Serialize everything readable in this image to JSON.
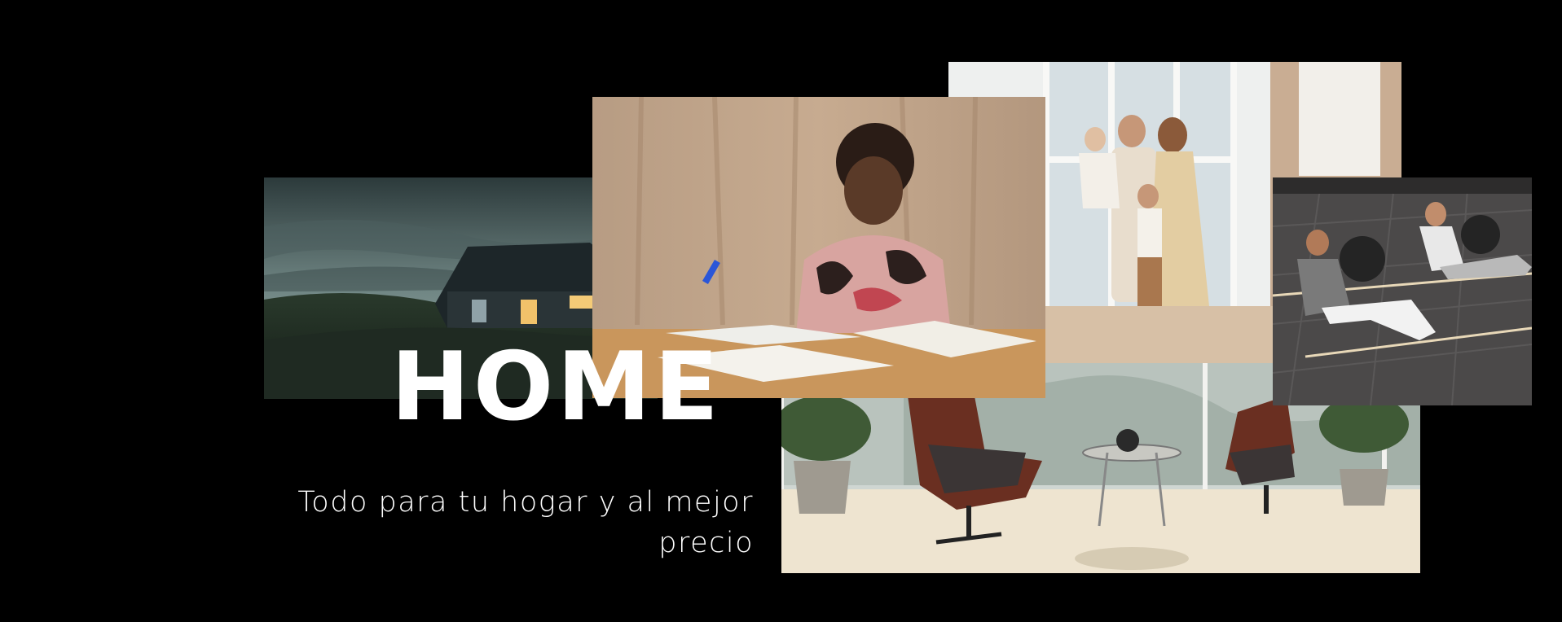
{
  "hero": {
    "title": "HOME",
    "subtitle_line1": "Todo para tu hogar y al mejor",
    "subtitle_line2": "precio",
    "background_color": "#000000",
    "text_color": "#ffffff"
  },
  "photos": [
    {
      "subject": "house-at-dusk-photo"
    },
    {
      "subject": "person-studying-photo"
    },
    {
      "subject": "family-photo"
    },
    {
      "subject": "fitness-photo"
    },
    {
      "subject": "lounge-chairs-photo"
    }
  ]
}
